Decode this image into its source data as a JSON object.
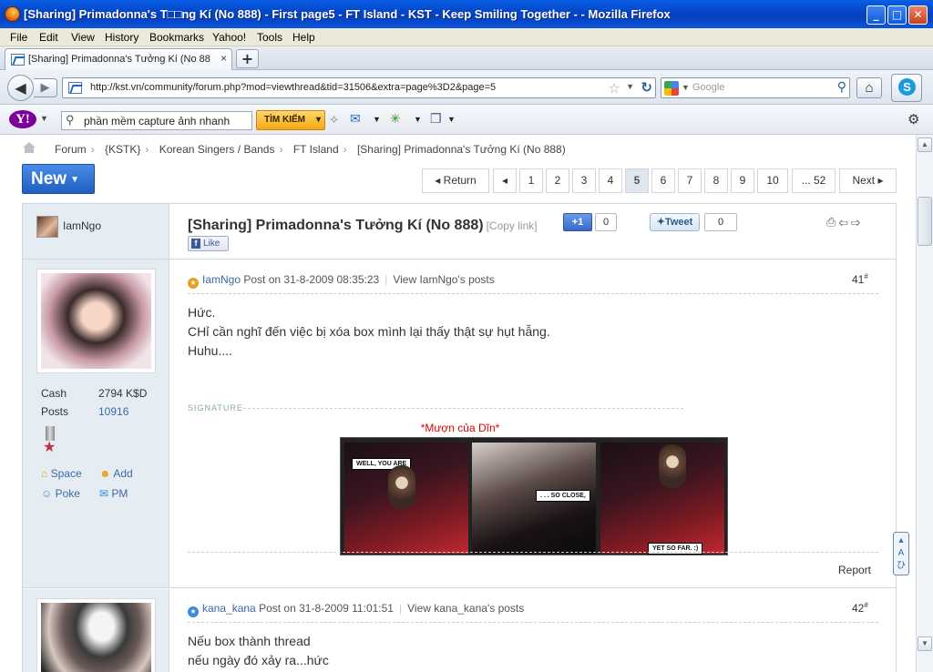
{
  "window": {
    "title": "[Sharing] Primadonna's T□□ng Kí (No 888) - First page5 - FT Island - KST - Keep Smiling Together - - Mozilla Firefox",
    "min": "_",
    "max": "□",
    "close": "✕"
  },
  "menu": [
    "File",
    "Edit",
    "View",
    "History",
    "Bookmarks",
    "Yahoo!",
    "Tools",
    "Help"
  ],
  "tab": {
    "label": "[Sharing] Primadonna's Tưởng Kí (No 888) - ...",
    "close": "×",
    "new": "+"
  },
  "nav": {
    "back": "◀",
    "forward": "▶",
    "url": "http://kst.vn/community/forum.php?mod=viewthread&tid=31506&extra=page%3D2&page=5",
    "search_placeholder": "Google",
    "home": "⌂"
  },
  "yahoo": {
    "logo": "Y!",
    "search_value": "phần mềm capture ảnh nhanh",
    "search_button": "TÌM KIẾM"
  },
  "breadcrumb": [
    "Forum",
    "{KSTK}",
    "Korean Singers / Bands",
    "FT Island",
    "[Sharing] Primadonna's Tưởng Kí (No 888)"
  ],
  "new_button": "New",
  "pagination": {
    "return": "Return",
    "prev": "◂",
    "pages": [
      "1",
      "2",
      "3",
      "4",
      "5",
      "6",
      "7",
      "8",
      "9",
      "10",
      "... 52"
    ],
    "current": "5",
    "next": "Next"
  },
  "thread": {
    "author": "IamNgo",
    "title": "[Sharing] Primadonna's Tưởng Kí (No 888)",
    "copy_link": "[Copy link]",
    "plusone": "+1",
    "plusone_count": "0",
    "tweet": "Tweet",
    "tweet_count": "0",
    "like": "Like"
  },
  "posts": [
    {
      "author": "IamNgo",
      "date_prefix": "Post on",
      "date": "31-8-2009 08:35:23",
      "view_posts": "View IamNgo's posts",
      "floor": "41",
      "lines": [
        "Hức.",
        "CHỉ cần nghĩ đến việc bị xóa box mình lại thấy thật sự hụt hẫng.",
        "Huhu...."
      ],
      "cash_label": "Cash",
      "cash": "2794 K$D",
      "posts_label": "Posts",
      "posts": "10916",
      "space": "Space",
      "add": "Add",
      "poke": "Poke",
      "pm": "PM",
      "signature_label": "SIGNATURE",
      "signature_title": "*Mượn của Dĩn*",
      "comic_bubbles": [
        "WELL, YOU ARE",
        ". . . SO CLOSE,",
        "YET SO FAR. :)"
      ],
      "report": "Report"
    },
    {
      "author": "kana_kana",
      "date_prefix": "Post on",
      "date": "31-8-2009 11:01:51",
      "view_posts": "View kana_kana's posts",
      "floor": "42",
      "lines": [
        "Nếu box thành thread",
        "nếu ngày đó xảy ra...hức"
      ]
    }
  ],
  "colors": {
    "accent": "#1f5fc0",
    "sidebar": "#e5edf2",
    "signature": "#dd0000"
  }
}
